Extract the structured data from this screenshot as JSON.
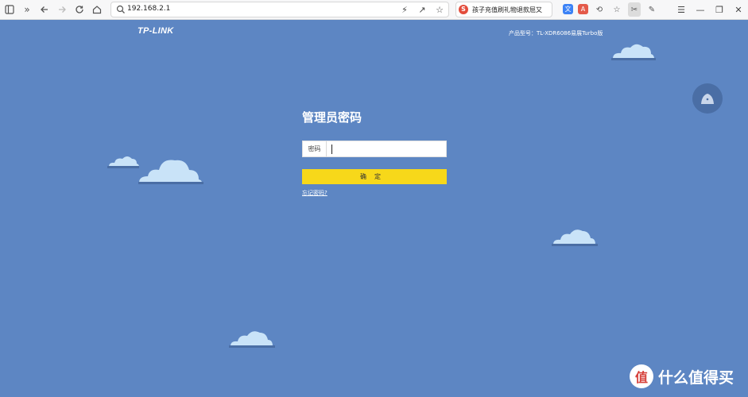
{
  "browser": {
    "url": "192.168.2.1",
    "news_badge": "S",
    "news_text": "孩子充值刷礼物退款屈又",
    "ext_translate": "文",
    "ext_pdf": "A"
  },
  "page": {
    "brand": "TP-LINK",
    "model_label": "产品型号：TL-XDR6086易展Turbo版",
    "title": "管理员密码",
    "password_label": "密码",
    "password_value": "",
    "confirm_label": "确定",
    "forgot_link": "忘记密码?"
  },
  "watermark": {
    "logo_char": "值",
    "text": "什么值得买"
  },
  "colors": {
    "background": "#5d86c3",
    "confirm_button": "#f7d81a",
    "cloud": "#c9e3f8",
    "help_button": "#4a6ea5"
  }
}
